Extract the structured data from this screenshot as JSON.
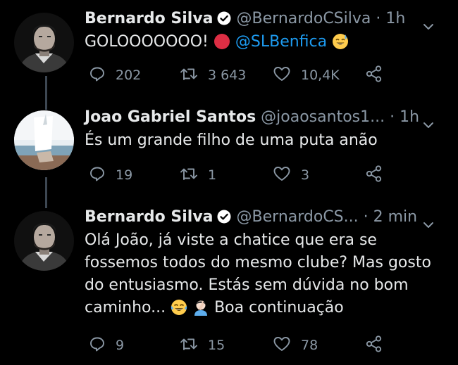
{
  "colors": {
    "background": "#000000",
    "text": "#e7e9ea",
    "muted": "#8b98a5",
    "link": "#1d9bf0",
    "thread_line": "#3d4752",
    "verified": "#ffffff"
  },
  "tweets": [
    {
      "name": "Bernardo Silva",
      "verified": true,
      "handle": "@BernardoCSilva",
      "separator": "·",
      "time": "1h",
      "text_before": "GOLOOOOOOO!",
      "mention": "@SLBenfica",
      "reply_count": "202",
      "retweet_count": "3 643",
      "like_count": "10,4K",
      "icons": [
        "reply-icon",
        "retweet-icon",
        "like-icon",
        "share-icon"
      ]
    },
    {
      "name": "Joao Gabriel Santos",
      "verified": false,
      "handle": "@joaosantos1...",
      "separator": "·",
      "time": "1h",
      "text": "És um grande filho de uma puta anão",
      "reply_count": "19",
      "retweet_count": "1",
      "like_count": "3"
    },
    {
      "name": "Bernardo Silva",
      "verified": true,
      "handle": "@BernardoCS...",
      "separator": "·",
      "time": "2 min",
      "lines": [
        "Olá João, já viste a chatice que era se",
        "fossemos todos do mesmo clube? Mas gosto",
        "do entusiasmo. Estás sem dúvida no bom",
        "caminho..."
      ],
      "text_after": "Boa continuação",
      "reply_count": "9",
      "retweet_count": "15",
      "like_count": "78"
    }
  ]
}
